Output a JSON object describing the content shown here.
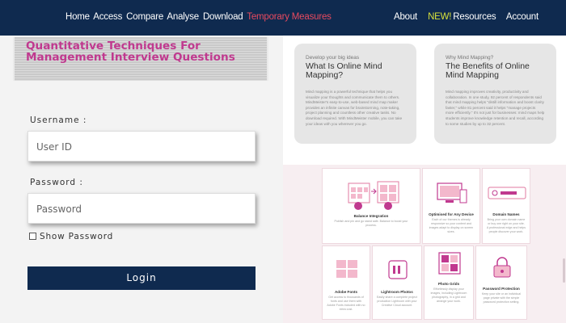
{
  "nav": {
    "left_items": [
      "Home",
      "Access",
      "Compare",
      "Analyse",
      "Download"
    ],
    "left_highlight": "Temporary Measures",
    "right_items": [
      "About"
    ],
    "new_badge": "NEW!",
    "resources": "Resources",
    "account": "Account"
  },
  "banner": {
    "text": "Quantitative Techniques For Management Interview Questions"
  },
  "login": {
    "username_label": "Username :",
    "username_placeholder": "User ID",
    "password_label": "Password :",
    "password_placeholder": "Password",
    "show_password": "Show Password",
    "login_button": "Login"
  },
  "cards": [
    {
      "subtitle": "Develop your big ideas",
      "title": "What Is Online Mind Mapping?",
      "body": "Mind mapping is a powerful technique that helps you visualize your thoughts and communicate them to others. MindMeister's easy-to-use, web-based mind map maker provides an infinite canvas for brainstorming, note-taking, project planning and countless other creative tasks. No download required. With MindMeister mobile, you can take your ideas with you wherever you go."
    },
    {
      "subtitle": "Why Mind Mapping?",
      "title": "The Benefits of Online Mind Mapping",
      "body": "Mind mapping improves creativity, productivity and collaboration. In one study, 92 percent of respondents said that mind mapping helps \"distill information and boost clarity faster,\" while 81 percent said it helps \"manage projects more efficiently.\" It's not just for businesses: mind maps help students improve knowledge retention and recall, according to some studies by up to 32 percent."
    }
  ],
  "features": [
    {
      "title": "Balance Integration",
      "desc": "Publish and pin and go stand safe. Balance to boost your process."
    },
    {
      "title": "Optimised for Any Device",
      "desc": "Each of our themes is already responsive so your content and images adapt to display on screen sizes."
    },
    {
      "title": "Domain Names",
      "desc": "Bring your own domain name or buy one right on your site. A professional edge and helps people discover your work."
    },
    {
      "title": "Adobe Fonts",
      "desc": "Get access to thousands of fonts and use them with Adobe Fonts included with no extra cost."
    },
    {
      "title": "Lightroom Photos",
      "desc": "Easily share a complete project production Lightroom with your Creative Cloud account."
    },
    {
      "title": "Photo Grids",
      "desc": "Effortlessly display your images, including Lightroom photography, in a grid and arrange your work."
    },
    {
      "title": "Password Protection",
      "desc": "Keep your site or an individual page private with the simple password protection setting."
    }
  ],
  "colors": {
    "nav_bg": "#0f2a4f",
    "accent_pink": "#c0398f",
    "highlight_red": "#e84a5f",
    "new_yellow": "#d8e23a"
  }
}
